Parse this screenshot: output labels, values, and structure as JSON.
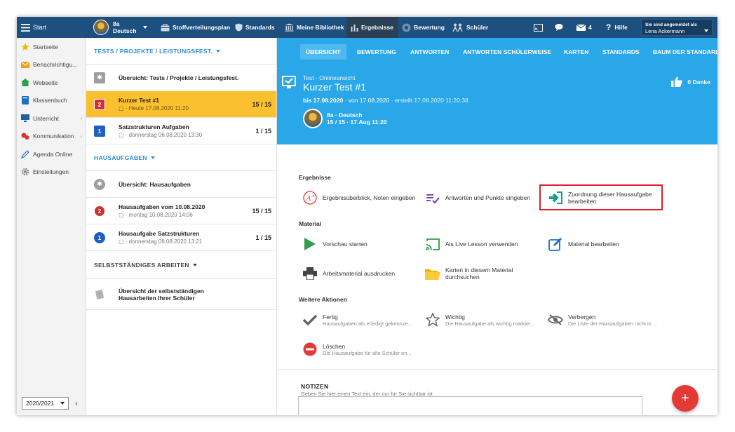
{
  "topbar": {
    "start_label": "Start",
    "class_line1": "8a",
    "class_line2": "Deutsch",
    "nav": [
      {
        "label": "Stoffverteilungsplan",
        "icon": "briefcase-icon"
      },
      {
        "label": "Standards",
        "icon": "shield-icon"
      },
      {
        "label": "Meine Bibliothek",
        "icon": "library-icon"
      },
      {
        "label": "Ergebnisse",
        "icon": "bar-chart-icon"
      },
      {
        "label": "Bewertung",
        "icon": "rating-icon"
      },
      {
        "label": "Schüler",
        "icon": "students-icon"
      }
    ],
    "mail_count": "4",
    "help_label": "Hilfe",
    "login_line1": "Sie sind angemeldet als",
    "login_line2": "Lena Ackermann"
  },
  "sidebar": {
    "items": [
      {
        "label": "Startseite",
        "icon": "star-icon"
      },
      {
        "label": "Benachrichtigu...",
        "icon": "mail-icon"
      },
      {
        "label": "Webseite",
        "icon": "home-icon"
      },
      {
        "label": "Klassenbuch",
        "icon": "book-icon"
      },
      {
        "label": "Unterricht",
        "icon": "monitor-icon"
      },
      {
        "label": "Kommunikation",
        "icon": "chat-icon"
      },
      {
        "label": "Agenda Online",
        "icon": "pen-icon"
      },
      {
        "label": "Einstellungen",
        "icon": "gear-icon"
      }
    ],
    "year": "2020/2021"
  },
  "list": {
    "section1_title": "TESTS / PROJEKTE / LEISTUNGSFEST.",
    "section1_items": [
      {
        "badge": "",
        "title": "Übersicht: Tests / Projekte / Leistungsfest.",
        "sub": "",
        "score": ""
      },
      {
        "badge": "2",
        "title": "Kurzer Test #1",
        "sub": "Heute 17.08.2020 11:20",
        "score": "15 / 15"
      },
      {
        "badge": "1",
        "title": "Satzstrukturen Aufgaben",
        "sub": "donnerstag 06.08.2020 13:30",
        "score": "1 / 15"
      }
    ],
    "section2_title": "HAUSAUFGABEN",
    "section2_items": [
      {
        "badge": "",
        "title": "Übersicht: Hausaufgaben",
        "sub": "",
        "score": ""
      },
      {
        "badge": "2",
        "title": "Hausaufgaben vom 10.08.2020",
        "sub": "montag 10.08.2020 14:06",
        "score": "15 / 15"
      },
      {
        "badge": "1",
        "title": "Hausaufgabe Satzstrukturen",
        "sub": "donnerstag 06.08.2020 13:21",
        "score": "1 / 15"
      }
    ],
    "section3_title": "SELBSTSTÄNDIGES ARBEITEN",
    "section3_item_line1": "Übersicht der selbstständigen",
    "section3_item_line2": "Hausarbeiten Ihrer Schüler"
  },
  "tabs": [
    "ÜBERSICHT",
    "BEWERTUNG",
    "ANTWORTEN",
    "ANTWORTEN SCHÜLERWEISE",
    "KARTEN",
    "STANDARDS",
    "BAUM DER STANDARDS"
  ],
  "hero": {
    "kind": "Test - Onlineansicht",
    "title": "Kurzer Test #1",
    "due": "bis 17.08.2020",
    "from": "· von 17.08.2020",
    "created": "· erstellt 17.08.2020 11:20:38",
    "class_name": "8a · Deutsch",
    "class_info": "15 / 15 · 17.Aug 11:20",
    "thanks": "0 Danke"
  },
  "groups": {
    "results_title": "Ergebnisse",
    "material_title": "Material",
    "more_title": "Weitere Aktionen"
  },
  "actions": {
    "overview": "Ergebnisüberblick, Noten eingeben",
    "answers": "Antworten und Punkte eingeben",
    "assign_l1": "Zuordnung dieser Hausaufgabe",
    "assign_l2": "bearbeiten",
    "preview": "Vorschau starten",
    "live": "Als Live Lesson verwenden",
    "edit_material": "Material bearbeiten",
    "print": "Arbeitsmaterial ausdrucken",
    "cards_l1": "Karten in diesem Material",
    "cards_l2": "durchsuchen",
    "done": "Fertig",
    "done_desc": "Hausaufgaben als erledigt gekennze...",
    "important": "Wichtig",
    "important_desc": "Die Hausaufgabe als wichtig markier...",
    "hide": "Verbergen",
    "hide_desc": "Die Liste der Hausaufgaben nicht in ...",
    "delete": "Löschen",
    "delete_desc": "Die Hausaufgabe für alle Schüler en..."
  },
  "notes": {
    "title": "NOTIZEN",
    "sub": "Geben Sie hier einen Text ein, der nur für Sie sichtbar ist"
  },
  "fab_label": "+",
  "colors": {
    "topbar": "#1d4f7f",
    "accent": "#29a7e8",
    "selected": "#fbc02d",
    "highlight": "#e01e2b"
  }
}
